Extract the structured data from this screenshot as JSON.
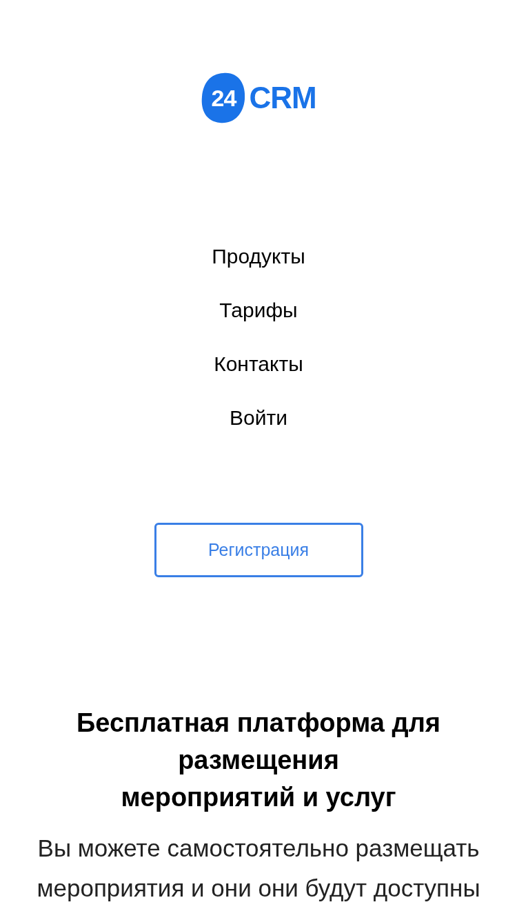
{
  "logo": {
    "badge": "24",
    "text": "CRM"
  },
  "nav": [
    {
      "label": "Продукты"
    },
    {
      "label": "Тарифы"
    },
    {
      "label": "Контакты"
    },
    {
      "label": "Войти"
    }
  ],
  "register_button": "Регистрация",
  "heading": [
    "Бесплатная платформа для",
    "размещения",
    "мероприятий и услуг"
  ],
  "intro": [
    "Вы можете самостоятельно размещать",
    "мероприятия и они они будут доступны"
  ]
}
